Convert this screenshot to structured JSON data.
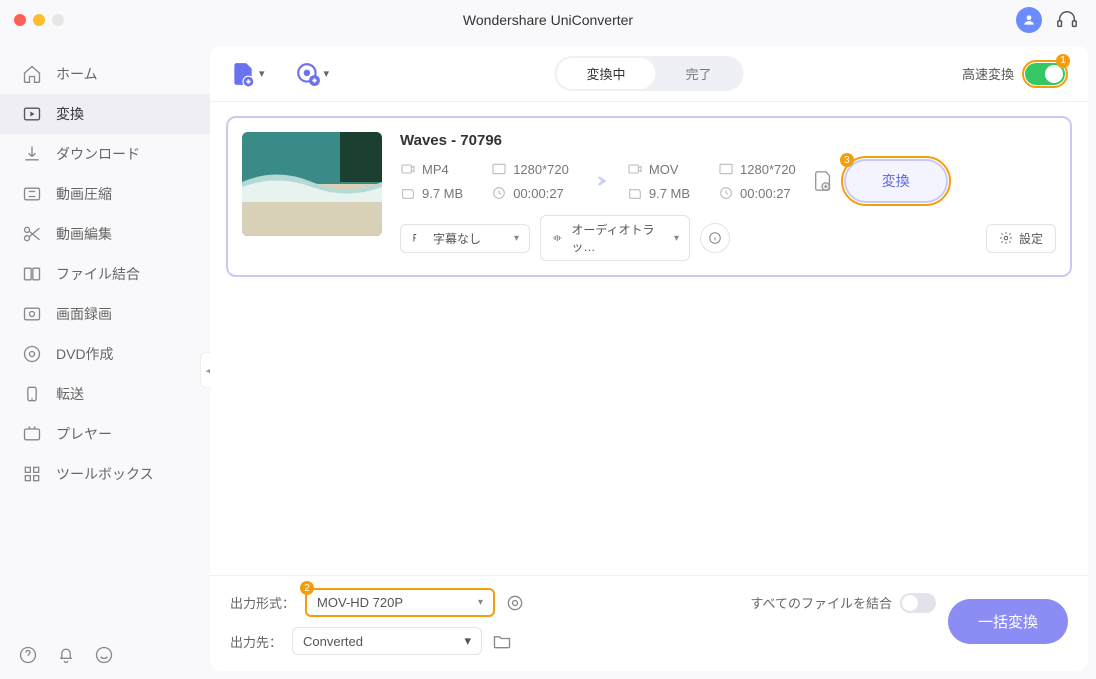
{
  "app": {
    "title": "Wondershare UniConverter"
  },
  "sidebar": {
    "items": [
      {
        "label": "ホーム"
      },
      {
        "label": "変換"
      },
      {
        "label": "ダウンロード"
      },
      {
        "label": "動画圧縮"
      },
      {
        "label": "動画編集"
      },
      {
        "label": "ファイル結合"
      },
      {
        "label": "画面録画"
      },
      {
        "label": "DVD作成"
      },
      {
        "label": "転送"
      },
      {
        "label": "プレヤー"
      },
      {
        "label": "ツールボックス"
      }
    ]
  },
  "toolbar": {
    "tabs": {
      "active": "変換中",
      "done": "完了"
    },
    "fast_label": "高速変換",
    "badge_fast": "1"
  },
  "file": {
    "name": "Waves - 70796",
    "src": {
      "format": "MP4",
      "res": "1280*720",
      "size": "9.7 MB",
      "dur": "00:00:27"
    },
    "dst": {
      "format": "MOV",
      "res": "1280*720",
      "size": "9.7 MB",
      "dur": "00:00:27"
    },
    "subtitle": "字幕なし",
    "audio": "オーディオトラッ…",
    "settings": "設定",
    "convert": "変換",
    "badge_convert": "3"
  },
  "footer": {
    "format_label": "出力形式：",
    "format_value": "MOV-HD 720P",
    "badge_format": "2",
    "dest_label": "出力先：",
    "dest_value": "Converted",
    "merge_label": "すべてのファイルを結合",
    "batch": "一括変換"
  }
}
